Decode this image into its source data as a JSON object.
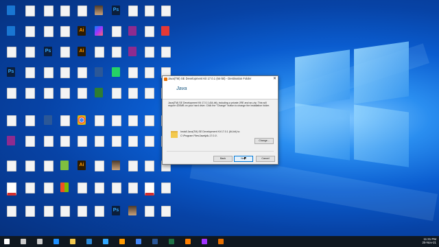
{
  "desktop_icons": [
    {
      "label": "",
      "kind": "g-blue"
    },
    {
      "label": "",
      "kind": "g-doc"
    },
    {
      "label": "",
      "kind": "g-doc"
    },
    {
      "label": "",
      "kind": "g-doc"
    },
    {
      "label": "",
      "kind": "g-doc"
    },
    {
      "label": "",
      "kind": "g-photo"
    },
    {
      "label": "",
      "kind": "g-ps"
    },
    {
      "label": "",
      "kind": "g-doc"
    },
    {
      "label": "",
      "kind": "g-doc"
    },
    {
      "label": "",
      "kind": "g-doc"
    },
    {
      "label": "",
      "kind": "g-blue"
    },
    {
      "label": "",
      "kind": "g-doc"
    },
    {
      "label": "",
      "kind": "g-doc"
    },
    {
      "label": "",
      "kind": "g-doc"
    },
    {
      "label": "",
      "kind": "g-ai"
    },
    {
      "label": "",
      "kind": "g-mess"
    },
    {
      "label": "",
      "kind": "g-doc"
    },
    {
      "label": "",
      "kind": "g-rar"
    },
    {
      "label": "",
      "kind": "g-doc"
    },
    {
      "label": "",
      "kind": "g-red"
    },
    {
      "label": "",
      "kind": "g-doc"
    },
    {
      "label": "",
      "kind": "g-doc"
    },
    {
      "label": "",
      "kind": "g-ps"
    },
    {
      "label": "",
      "kind": "g-doc"
    },
    {
      "label": "",
      "kind": "g-ai"
    },
    {
      "label": "",
      "kind": "g-doc"
    },
    {
      "label": "",
      "kind": "g-doc"
    },
    {
      "label": "",
      "kind": "g-rar"
    },
    {
      "label": "",
      "kind": "g-doc"
    },
    {
      "label": "",
      "kind": "g-doc"
    },
    {
      "label": "",
      "kind": "g-ps"
    },
    {
      "label": "",
      "kind": "g-doc"
    },
    {
      "label": "",
      "kind": "g-doc"
    },
    {
      "label": "",
      "kind": "g-doc"
    },
    {
      "label": "",
      "kind": "g-doc"
    },
    {
      "label": "",
      "kind": "g-word"
    },
    {
      "label": "",
      "kind": "g-wa"
    },
    {
      "label": "",
      "kind": "g-doc"
    },
    {
      "label": "",
      "kind": "g-doc"
    },
    {
      "label": "",
      "kind": "g-doc"
    },
    {
      "label": "",
      "kind": "g-doc"
    },
    {
      "label": "",
      "kind": "g-doc"
    },
    {
      "label": "",
      "kind": "g-doc"
    },
    {
      "label": "",
      "kind": "g-doc"
    },
    {
      "label": "",
      "kind": "g-doc"
    },
    {
      "label": "",
      "kind": "g-green"
    },
    {
      "label": "",
      "kind": "g-doc"
    },
    {
      "label": "",
      "kind": "g-doc"
    },
    {
      "label": "",
      "kind": "g-doc"
    },
    {
      "label": "",
      "kind": "g-doc"
    },
    {
      "label": "",
      "kind": "g-doc"
    },
    {
      "label": "",
      "kind": "g-doc"
    },
    {
      "label": "",
      "kind": "g-word"
    },
    {
      "label": "",
      "kind": "g-doc"
    },
    {
      "label": "",
      "kind": "g-chrome"
    },
    {
      "label": "",
      "kind": "g-doc"
    },
    {
      "label": "",
      "kind": "g-doc"
    },
    {
      "label": "",
      "kind": "g-doc"
    },
    {
      "label": "",
      "kind": "g-doc"
    },
    {
      "label": "",
      "kind": "g-doc"
    },
    {
      "label": "",
      "kind": "g-rar"
    },
    {
      "label": "",
      "kind": "g-doc"
    },
    {
      "label": "",
      "kind": "g-doc"
    },
    {
      "label": "",
      "kind": "g-doc"
    },
    {
      "label": "",
      "kind": "g-doc"
    },
    {
      "label": "",
      "kind": "g-doc"
    },
    {
      "label": "",
      "kind": "g-doc"
    },
    {
      "label": "",
      "kind": "g-doc"
    },
    {
      "label": "",
      "kind": "g-doc"
    },
    {
      "label": "",
      "kind": "g-doc"
    },
    {
      "label": "",
      "kind": "g-doc"
    },
    {
      "label": "",
      "kind": "g-doc"
    },
    {
      "label": "",
      "kind": "g-doc"
    },
    {
      "label": "",
      "kind": "g-ex"
    },
    {
      "label": "",
      "kind": "g-ai"
    },
    {
      "label": "",
      "kind": "g-doc"
    },
    {
      "label": "",
      "kind": "g-photo"
    },
    {
      "label": "",
      "kind": "g-doc"
    },
    {
      "label": "",
      "kind": "g-doc"
    },
    {
      "label": "",
      "kind": "g-doc"
    },
    {
      "label": "",
      "kind": "g-pdf"
    },
    {
      "label": "",
      "kind": "g-doc"
    },
    {
      "label": "",
      "kind": "g-doc"
    },
    {
      "label": "",
      "kind": "g-win"
    },
    {
      "label": "",
      "kind": "g-doc"
    },
    {
      "label": "",
      "kind": "g-doc"
    },
    {
      "label": "",
      "kind": "g-doc"
    },
    {
      "label": "",
      "kind": "g-doc"
    },
    {
      "label": "",
      "kind": "g-pdf"
    },
    {
      "label": "",
      "kind": "g-doc"
    },
    {
      "label": "",
      "kind": "g-doc"
    },
    {
      "label": "",
      "kind": "g-doc"
    },
    {
      "label": "",
      "kind": "g-doc"
    },
    {
      "label": "",
      "kind": "g-doc"
    },
    {
      "label": "",
      "kind": "g-doc"
    },
    {
      "label": "",
      "kind": "g-doc"
    },
    {
      "label": "",
      "kind": "g-ps"
    },
    {
      "label": "",
      "kind": "g-photo"
    },
    {
      "label": "",
      "kind": "g-doc"
    },
    {
      "label": "",
      "kind": "g-doc"
    },
    {
      "label": "",
      "kind": "g-tg"
    },
    {
      "label": "",
      "kind": "g-doc"
    },
    {
      "label": "",
      "kind": "g-doc"
    },
    {
      "label": "",
      "kind": "g-ps"
    },
    {
      "label": "",
      "kind": "g-doc"
    },
    {
      "label": "",
      "kind": "g-ps"
    },
    {
      "label": "",
      "kind": "g-ai"
    },
    {
      "label": "",
      "kind": "g-doc"
    },
    {
      "label": "",
      "kind": "g-tg"
    }
  ],
  "dialog": {
    "title": "Java(TM) SE Development Kit 17.0.1 (64-bit) - Destination Folder",
    "close_glyph": "✕",
    "java_logo_text": "Java",
    "description": "Java(TM) SE Development Kit 17.0.1 (64-bit), including a private JRE and src.zip. This will require 420MB on your hard drive. Click the \"Change\" button to change the installation folder.",
    "install_label": "Install Java(TM) SE Development Kit 17.0.1 (64-bit) to:",
    "install_path": "C:\\Program Files\\Java\\jdk-17.0.1\\",
    "change_button": "Change...",
    "back_button": "Back",
    "next_button": "Next",
    "cancel_button": "Cancel"
  },
  "taskbar": {
    "time": "11:31 PM",
    "date": "25-Nov-21",
    "apps": [
      "start-icon",
      "search-icon",
      "task-view-icon",
      "edge-icon",
      "explorer-icon",
      "store-icon",
      "ps-icon",
      "ai-icon",
      "chrome-icon",
      "word-icon",
      "excel-icon",
      "vlc-icon",
      "mess-icon",
      "java-icon"
    ]
  }
}
